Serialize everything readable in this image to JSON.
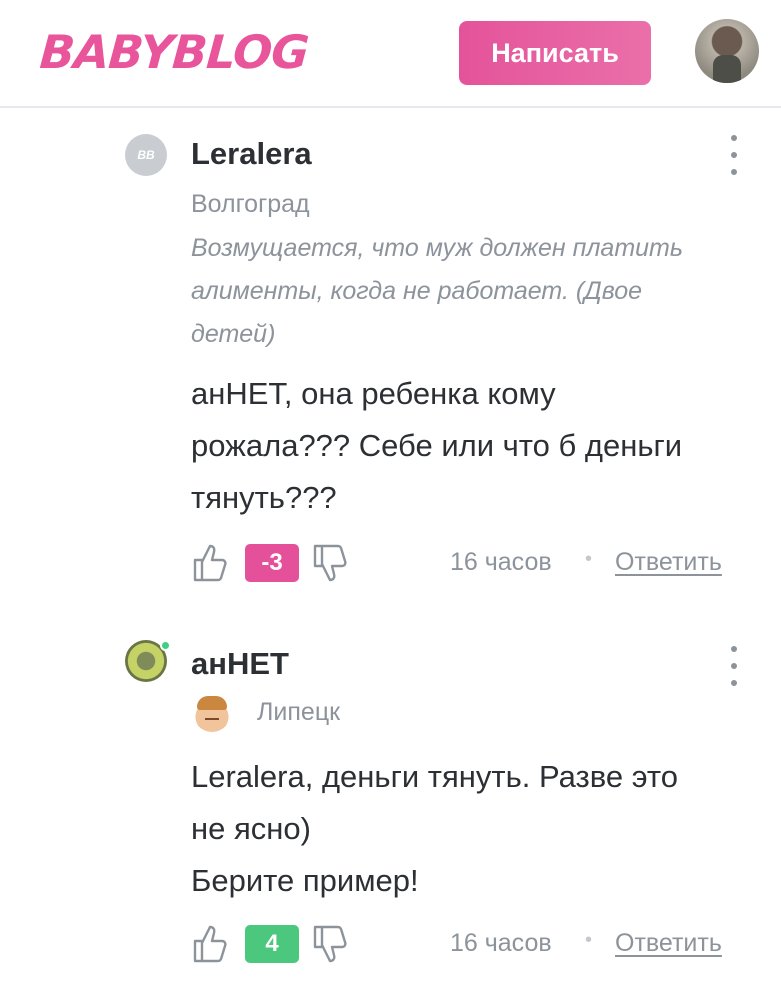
{
  "header": {
    "logo": "BABYBLOG",
    "write_button": "Написать"
  },
  "comments": [
    {
      "author": "Leralera",
      "avatar_text": "BB",
      "city": "Волгоград",
      "quote": "Возмущается, что муж должен платить алименты, когда не работает. (Двое детей)",
      "text_lines": [
        "анНЕТ, она ребенка кому",
        "рожала??? Себе или что б деньги",
        "тянуть???"
      ],
      "score": "-3",
      "time": "16 часов",
      "reply": "Ответить"
    },
    {
      "author": "анНЕТ",
      "city": "Липецк",
      "text_lines": [
        "Leralera, деньги тянуть. Разве это",
        "не ясно)",
        "Берите пример!"
      ],
      "score": "4",
      "time": "16 часов",
      "reply": "Ответить"
    }
  ],
  "colors": {
    "brand_pink": "#e8559a",
    "negative_score": "#e5509a",
    "positive_score": "#4cc77e",
    "online": "#3fcf7f",
    "muted_text": "#8c939b"
  },
  "icons": {
    "like": "thumb-up-icon",
    "dislike": "thumb-down-icon",
    "menu": "more-vertical-icon"
  }
}
